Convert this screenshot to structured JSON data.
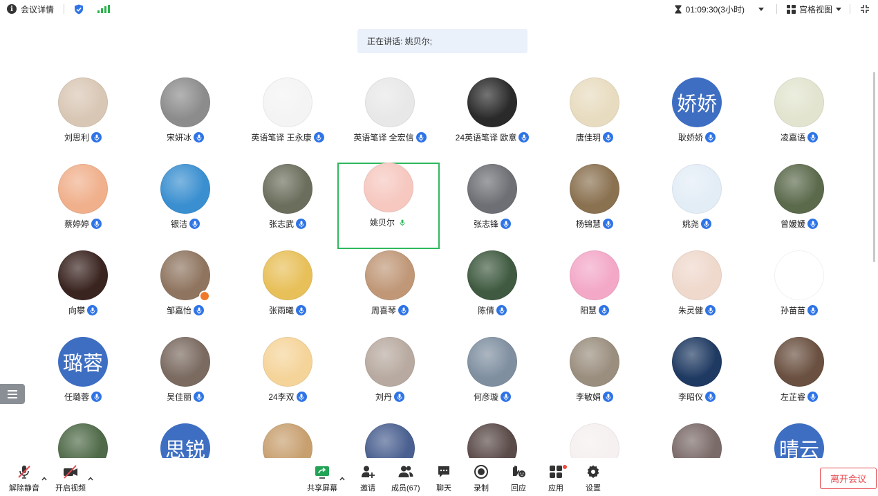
{
  "topbar": {
    "meeting_info_label": "会议详情",
    "timer": "01:09:30(3小时)",
    "view_mode": "宫格视图"
  },
  "speaking_banner": "正在讲话: 姚贝尔;",
  "participants": [
    {
      "name": "刘思利",
      "avatar_color": "#d9c7b5"
    },
    {
      "name": "宋妍冰",
      "avatar_color": "#8c8c8c"
    },
    {
      "name": "英语笔译 王永康",
      "avatar_color": "#f4f4f4"
    },
    {
      "name": "英语笔译 全宏信",
      "avatar_color": "#e8e8e8"
    },
    {
      "name": "24英语笔译 欧意",
      "avatar_color": "#2a2a2a"
    },
    {
      "name": "唐佳玥",
      "avatar_color": "#e8dcc0"
    },
    {
      "name": "耿娇娇",
      "avatar_text": "娇娇"
    },
    {
      "name": "凌嘉语",
      "avatar_color": "#e2e4cf"
    },
    {
      "name": "蔡婷婷",
      "avatar_color": "#f0b08c"
    },
    {
      "name": "银洁",
      "avatar_color": "#3a8fd0"
    },
    {
      "name": "张志武",
      "avatar_color": "#6b6e5c"
    },
    {
      "name": "姚贝尔",
      "avatar_color": "#f6c8c0",
      "active": true
    },
    {
      "name": "张志锋",
      "avatar_color": "#6d6f74"
    },
    {
      "name": "杨锦慧",
      "avatar_color": "#8a7150"
    },
    {
      "name": "姚尧",
      "avatar_color": "#e3edf6"
    },
    {
      "name": "曾媛媛",
      "avatar_color": "#5c6a4c"
    },
    {
      "name": "向攀",
      "avatar_color": "#3a2420"
    },
    {
      "name": "邹嘉怡",
      "avatar_color": "#8f7560",
      "host": true
    },
    {
      "name": "张雨曦",
      "avatar_color": "#e8c05a"
    },
    {
      "name": "周喜琴",
      "avatar_color": "#c09878"
    },
    {
      "name": "陈倩",
      "avatar_color": "#3f5a40"
    },
    {
      "name": "阳慧",
      "avatar_color": "#f3a8c8"
    },
    {
      "name": "朱灵健",
      "avatar_color": "#efd8cc"
    },
    {
      "name": "孙苗苗",
      "avatar_color": "#ffffff"
    },
    {
      "name": "任璐蓉",
      "avatar_text": "璐蓉"
    },
    {
      "name": "吴佳丽",
      "avatar_color": "#7a6a60"
    },
    {
      "name": "24李双",
      "avatar_color": "#f5d49a"
    },
    {
      "name": "刘丹",
      "avatar_color": "#b8aaa0"
    },
    {
      "name": "何彦璇",
      "avatar_color": "#7f8fa0"
    },
    {
      "name": "李敏娟",
      "avatar_color": "#9a8e7e"
    },
    {
      "name": "李昭仪",
      "avatar_color": "#1f3a62"
    },
    {
      "name": "左芷睿",
      "avatar_color": "#6a5040"
    },
    {
      "name": "",
      "avatar_color": "#4f6a48"
    },
    {
      "name": "",
      "avatar_text": "思锐"
    },
    {
      "name": "",
      "avatar_color": "#c8a070"
    },
    {
      "name": "",
      "avatar_color": "#4a6090"
    },
    {
      "name": "",
      "avatar_color": "#5a4a48"
    },
    {
      "name": "",
      "avatar_color": "#f6f0f0"
    },
    {
      "name": "",
      "avatar_color": "#7a6a68"
    },
    {
      "name": "",
      "avatar_text": "晴云"
    }
  ],
  "toolbar": {
    "unmute": "解除静音",
    "start_video": "开启视频",
    "share_screen": "共享屏幕",
    "invite": "邀请",
    "members": "成员(67)",
    "chat": "聊天",
    "record": "录制",
    "reactions": "回应",
    "apps": "应用",
    "settings": "设置",
    "leave": "离开会议"
  },
  "colors": {
    "accent": "#2f74e6",
    "active_border": "#2eb85c",
    "leave": "#e5484d",
    "text_avatar": "#3e6ec2"
  }
}
